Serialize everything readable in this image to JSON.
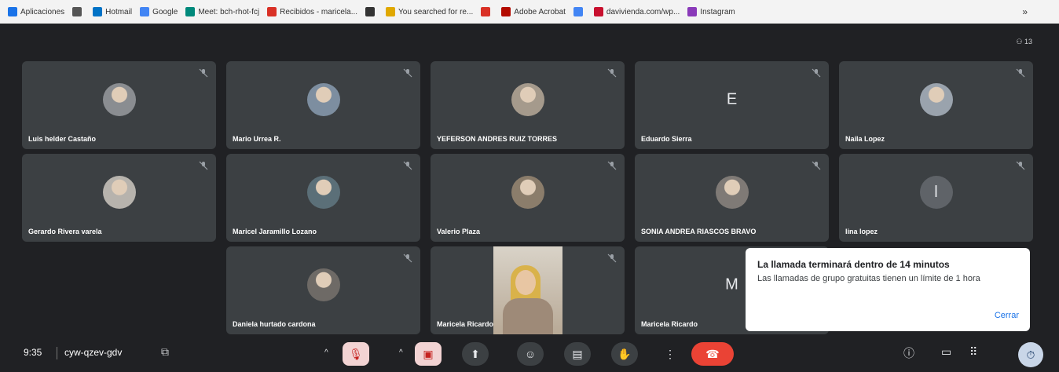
{
  "bookmarks": {
    "items": [
      {
        "label": "Aplicaciones",
        "icon": "apps-grid-icon",
        "color": "#1a73e8"
      },
      {
        "label": "",
        "icon": "grid-icon",
        "color": "#555555"
      },
      {
        "label": "Hotmail",
        "icon": "hotmail-icon",
        "color": "#0072c6"
      },
      {
        "label": "Google",
        "icon": "google-icon",
        "color": "#4285f4"
      },
      {
        "label": "Meet: bch-rhot-fcj",
        "icon": "meet-icon",
        "color": "#00897b"
      },
      {
        "label": "Recibidos - maricela...",
        "icon": "gmail-icon",
        "color": "#d93025"
      },
      {
        "label": "",
        "icon": "globe-icon",
        "color": "#333333"
      },
      {
        "label": "You searched for re...",
        "icon": "wordpress-icon",
        "color": "#e0a800"
      },
      {
        "label": "",
        "icon": "gmail-icon",
        "color": "#d93025"
      },
      {
        "label": "Adobe Acrobat",
        "icon": "acrobat-icon",
        "color": "#b30b00"
      },
      {
        "label": "",
        "icon": "google-icon",
        "color": "#4285f4"
      },
      {
        "label": "davivienda.com/wp...",
        "icon": "davivienda-icon",
        "color": "#c8102e"
      },
      {
        "label": "Instagram",
        "icon": "instagram-icon",
        "color": "#8a3ab9"
      }
    ],
    "more": "»"
  },
  "top_indicator": {
    "label": "13"
  },
  "participants": [
    {
      "name": "Luis helder Castaño",
      "avatar": "photo",
      "color": "#8a8d91"
    },
    {
      "name": "Mario Urrea R.",
      "avatar": "photo",
      "color": "#7d8ea0"
    },
    {
      "name": "YEFERSON ANDRES RUIZ TORRES",
      "avatar": "photo",
      "color": "#a59a8c"
    },
    {
      "name": "Eduardo Sierra",
      "avatar": "initial",
      "initial": "E",
      "color": "#3c4043"
    },
    {
      "name": "Naila Lopez",
      "avatar": "photo",
      "color": "#9aa3ad"
    },
    {
      "name": "Gerardo Rivera varela",
      "avatar": "photo",
      "color": "#b7b3ad"
    },
    {
      "name": "Maricel Jaramillo Lozano",
      "avatar": "photo",
      "color": "#5b6f78"
    },
    {
      "name": "Valerio Plaza",
      "avatar": "photo",
      "color": "#8b7d6b"
    },
    {
      "name": "SONIA ANDREA RIASCOS BRAVO",
      "avatar": "photo",
      "color": "#7f7a76"
    },
    {
      "name": "lina lopez",
      "avatar": "initial",
      "initial": "l",
      "color": "#5f6368"
    },
    {
      "name": "Daniela hurtado cardona",
      "avatar": "photo",
      "color": "#6e6a66"
    },
    {
      "name": "Maricela Ricardo",
      "avatar": "video",
      "color": "#c4b8a6"
    },
    {
      "name": "Maricela Ricardo",
      "avatar": "initial",
      "initial": "M",
      "color": "#3c4043"
    }
  ],
  "toast": {
    "title": "La llamada terminará dentro de 14 minutos",
    "body": "Las llamadas de grupo gratuitas tienen un límite de 1 hora",
    "close": "Cerrar"
  },
  "bottom": {
    "time": "9:35",
    "meeting_code": "cyw-qzev-gdv"
  },
  "colors": {
    "background": "#202124",
    "tile": "#3c4043",
    "hangup": "#ea4335",
    "link": "#1a73e8"
  }
}
